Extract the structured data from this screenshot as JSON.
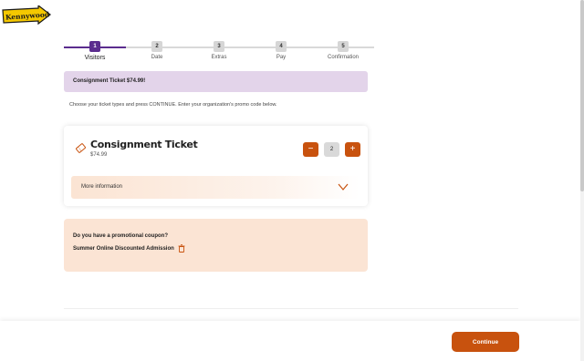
{
  "logo": {
    "text": "Kennywood"
  },
  "stepper": {
    "steps": [
      {
        "number": "1",
        "label": "Visitors"
      },
      {
        "number": "2",
        "label": "Date"
      },
      {
        "number": "3",
        "label": "Extras"
      },
      {
        "number": "4",
        "label": "Pay"
      },
      {
        "number": "5",
        "label": "Confirmation"
      }
    ],
    "active_step": 1
  },
  "banner": {
    "text": "Consignment Ticket $74.99!"
  },
  "intro": {
    "text": "Choose your ticket types and press CONTINUE. Enter your organization's promo code below."
  },
  "ticket": {
    "name": "Consignment Ticket",
    "price": "$74.99",
    "quantity": "2",
    "minus_label": "−",
    "plus_label": "+",
    "more_info_label": "More information"
  },
  "promo": {
    "question": "Do you have a promotional coupon?",
    "applied_code": "Summer Online Discounted Admission"
  },
  "footer": {
    "continue_label": "Continue"
  },
  "colors": {
    "accent": "#c8520e",
    "brand_purple": "#5b2d8e",
    "banner_bg": "#e3d4ea",
    "promo_bg": "#fbe4d4"
  }
}
